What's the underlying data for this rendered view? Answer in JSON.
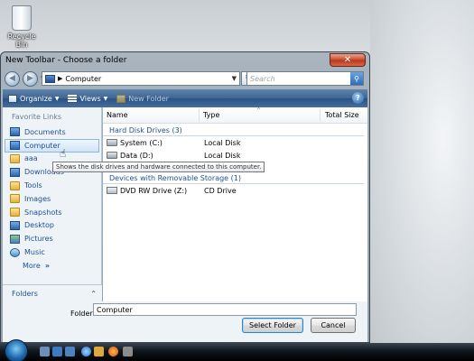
{
  "desktop": {
    "recycle_label": "Recycle Bin"
  },
  "window": {
    "title": "New Toolbar - Choose a folder",
    "close_glyph": "✕",
    "address_text": "Computer",
    "search_placeholder": "Search",
    "toolbar": {
      "organize": "Organize",
      "views": "Views",
      "new_folder": "New Folder",
      "help": "?"
    }
  },
  "sidebar": {
    "title": "Favorite Links",
    "items": [
      {
        "label": "Documents",
        "icon": "documents-icon"
      },
      {
        "label": "Computer",
        "icon": "computer-icon"
      },
      {
        "label": "aaa",
        "icon": "folder-icon"
      },
      {
        "label": "Downloads",
        "icon": "downloads-icon"
      },
      {
        "label": "Tools",
        "icon": "folder-icon"
      },
      {
        "label": "Images",
        "icon": "folder-icon"
      },
      {
        "label": "Snapshots",
        "icon": "folder-icon"
      },
      {
        "label": "Desktop",
        "icon": "desktop-icon"
      },
      {
        "label": "Pictures",
        "icon": "pictures-icon"
      },
      {
        "label": "Music",
        "icon": "music-icon"
      },
      {
        "label": "More",
        "icon": "chevron-right-icon"
      }
    ],
    "folders_label": "Folders"
  },
  "columns": {
    "name": "Name",
    "type": "Type",
    "total_size": "Total Size"
  },
  "groups": [
    {
      "label": "Hard Disk Drives (3)",
      "rows": [
        {
          "name": "System (C:)",
          "type": "Local Disk"
        },
        {
          "name": "Data (D:)",
          "type": "Local Disk"
        }
      ]
    },
    {
      "label": "Devices with Removable Storage (1)",
      "rows": [
        {
          "name": "DVD RW Drive (Z:)",
          "type": "CD Drive"
        }
      ]
    }
  ],
  "tooltip": "Shows the disk drives and hardware connected to this computer.",
  "footer": {
    "folder_label": "Folder:",
    "folder_value": "Computer",
    "select_button": "Select Folder",
    "cancel_button": "Cancel"
  }
}
